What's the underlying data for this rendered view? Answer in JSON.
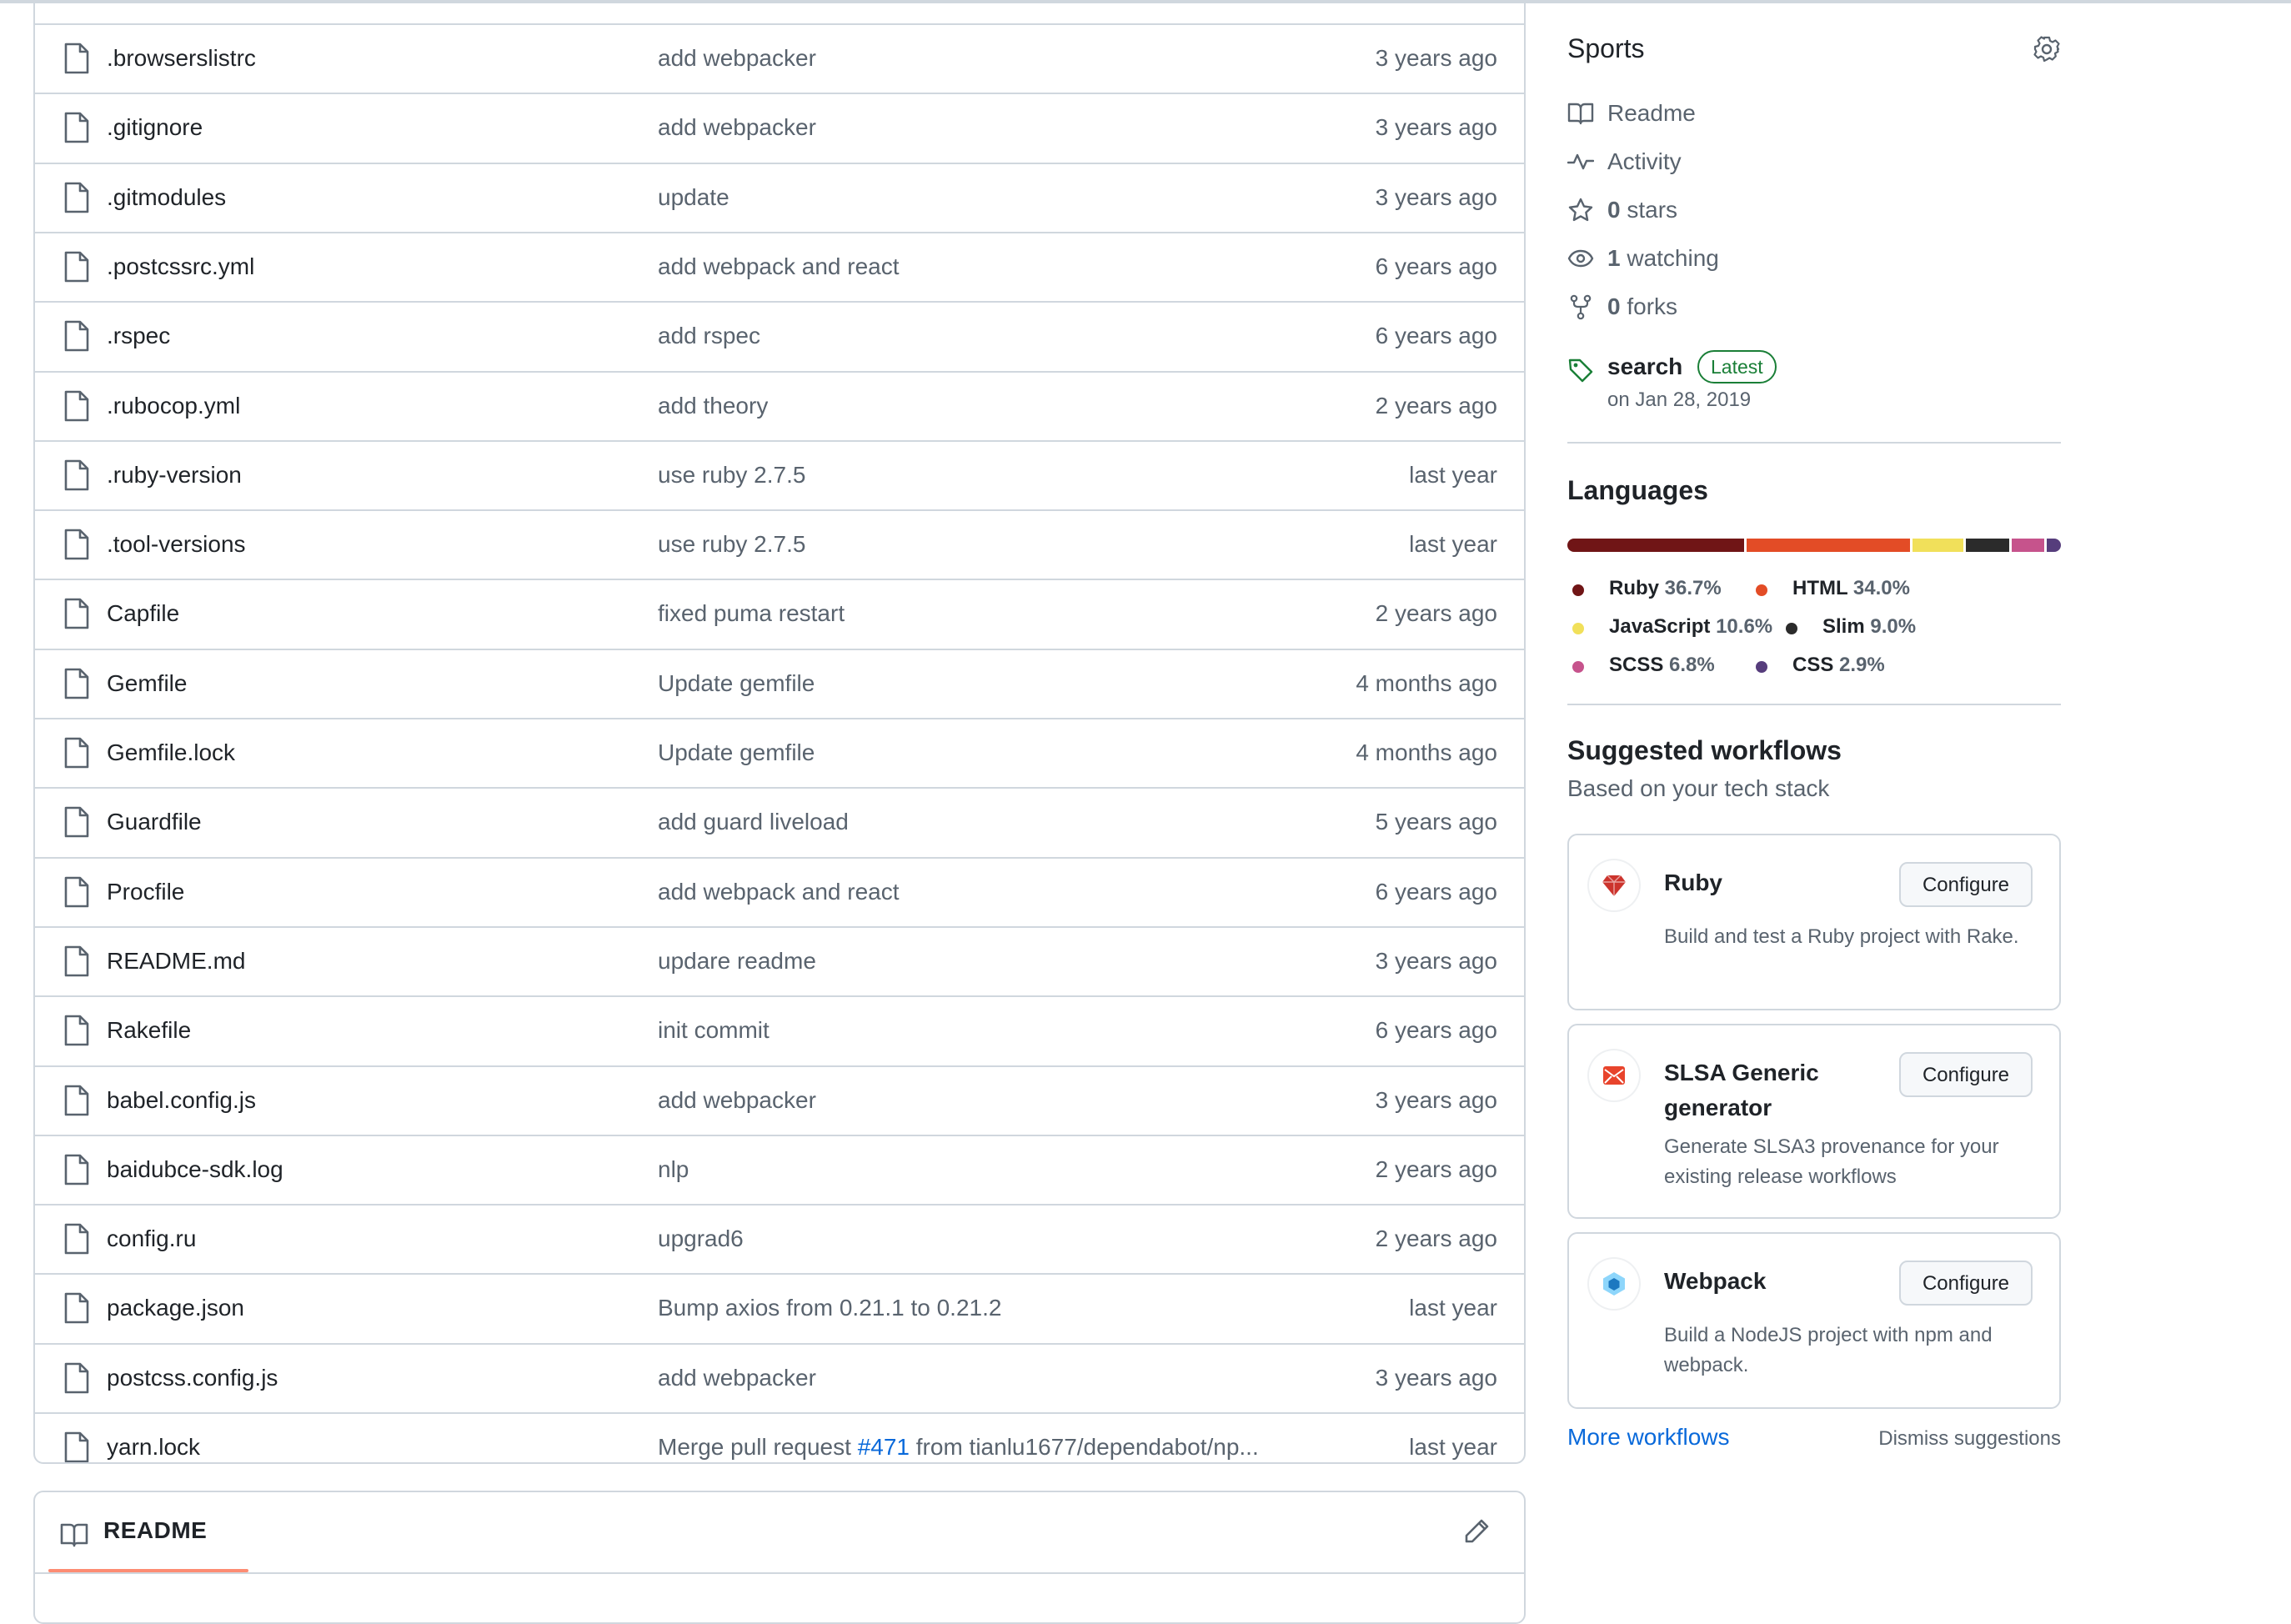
{
  "files": [
    {
      "name": ".browserslistrc",
      "message": "add webpacker",
      "date": "3 years ago"
    },
    {
      "name": ".gitignore",
      "message": "add webpacker",
      "date": "3 years ago"
    },
    {
      "name": ".gitmodules",
      "message": "update",
      "date": "3 years ago"
    },
    {
      "name": ".postcssrc.yml",
      "message": "add webpack and react",
      "date": "6 years ago"
    },
    {
      "name": ".rspec",
      "message": "add rspec",
      "date": "6 years ago"
    },
    {
      "name": ".rubocop.yml",
      "message": "add theory",
      "date": "2 years ago"
    },
    {
      "name": ".ruby-version",
      "message": "use ruby 2.7.5",
      "date": "last year"
    },
    {
      "name": ".tool-versions",
      "message": "use ruby 2.7.5",
      "date": "last year"
    },
    {
      "name": "Capfile",
      "message": "fixed puma restart",
      "date": "2 years ago"
    },
    {
      "name": "Gemfile",
      "message": "Update gemfile",
      "date": "4 months ago"
    },
    {
      "name": "Gemfile.lock",
      "message": "Update gemfile",
      "date": "4 months ago"
    },
    {
      "name": "Guardfile",
      "message": "add guard liveload",
      "date": "5 years ago"
    },
    {
      "name": "Procfile",
      "message": "add webpack and react",
      "date": "6 years ago"
    },
    {
      "name": "README.md",
      "message": "updare readme",
      "date": "3 years ago"
    },
    {
      "name": "Rakefile",
      "message": "init commit",
      "date": "6 years ago"
    },
    {
      "name": "babel.config.js",
      "message": "add webpacker",
      "date": "3 years ago"
    },
    {
      "name": "baidubce-sdk.log",
      "message": "nlp",
      "date": "2 years ago"
    },
    {
      "name": "config.ru",
      "message": "upgrad6",
      "date": "2 years ago"
    },
    {
      "name": "package.json",
      "message": "Bump axios from 0.21.1 to 0.21.2",
      "date": "last year"
    },
    {
      "name": "postcss.config.js",
      "message": "add webpacker",
      "date": "3 years ago"
    },
    {
      "name": "yarn.lock",
      "message_prefix": "Merge pull request ",
      "message_link": "#471",
      "message_suffix": " from tianlu1677/dependabot/np...",
      "date": "last year"
    }
  ],
  "readme": {
    "title": "README",
    "icon": "book-icon",
    "edit_icon": "pencil-icon"
  },
  "about": {
    "title": "Sports",
    "settings_icon": "gear-icon",
    "items": [
      {
        "icon": "book-icon",
        "count": "",
        "label": "Readme"
      },
      {
        "icon": "pulse-icon",
        "count": "",
        "label": "Activity"
      },
      {
        "icon": "star-icon",
        "count": "0",
        "label": " stars"
      },
      {
        "icon": "eye-icon",
        "count": "1",
        "label": " watching"
      },
      {
        "icon": "fork-icon",
        "count": "0",
        "label": " forks"
      }
    ],
    "release": {
      "name": "search",
      "badge": "Latest",
      "date": "on Jan 28, 2019"
    }
  },
  "languages": {
    "title": "Languages",
    "items": [
      {
        "name": "Ruby",
        "percent": "36.7%",
        "value": 36.7,
        "color": "#701516"
      },
      {
        "name": "HTML",
        "percent": "34.0%",
        "value": 34.0,
        "color": "#e34c26"
      },
      {
        "name": "JavaScript",
        "percent": "10.6%",
        "value": 10.6,
        "color": "#f1e05a"
      },
      {
        "name": "Slim",
        "percent": "9.0%",
        "value": 9.0,
        "color": "#2b2b2b"
      },
      {
        "name": "SCSS",
        "percent": "6.8%",
        "value": 6.8,
        "color": "#c6538c"
      },
      {
        "name": "CSS",
        "percent": "2.9%",
        "value": 2.9,
        "color": "#563d7c"
      }
    ]
  },
  "workflows": {
    "title": "Suggested workflows",
    "subtitle": "Based on your tech stack",
    "configure_label": "Configure",
    "items": [
      {
        "name": "Ruby",
        "description": "Build and test a Ruby project with Rake.",
        "icon": "ruby-icon"
      },
      {
        "name": "SLSA Generic generator",
        "description": "Generate SLSA3 provenance for your existing release workflows",
        "icon": "slsa-icon"
      },
      {
        "name": "Webpack",
        "description": "Build a NodeJS project with npm and webpack.",
        "icon": "webpack-icon"
      }
    ],
    "more_label": "More workflows",
    "dismiss_label": "Dismiss suggestions"
  }
}
